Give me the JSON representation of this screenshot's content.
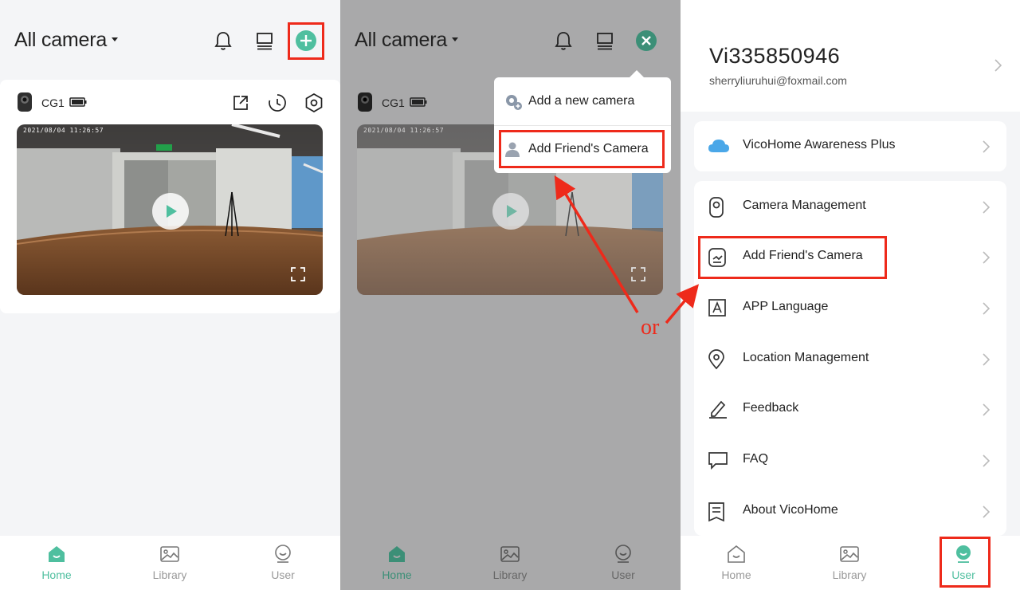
{
  "home": {
    "title": "All camera",
    "camera": {
      "name": "CG1",
      "timestamp": "2021/08/04 11:26:57"
    }
  },
  "dropdown": {
    "add_new_camera": "Add a new camera",
    "add_friends_camera": "Add Friend's Camera"
  },
  "nav": {
    "home": "Home",
    "library": "Library",
    "user": "User"
  },
  "user": {
    "username": "Vi335850946",
    "email": "sherryliuruhui@foxmail.com",
    "awareness_plus": "VicoHome Awareness Plus",
    "menu": [
      "Camera Management",
      "Add Friend's Camera",
      "APP Language",
      "Location Management",
      "Feedback",
      "FAQ",
      "About VicoHome"
    ]
  },
  "annotation": {
    "or_label": "or"
  },
  "colors": {
    "accent": "#4fbf9f",
    "highlight": "#ee2a1b",
    "dim_bg": "#a9a9aa"
  }
}
